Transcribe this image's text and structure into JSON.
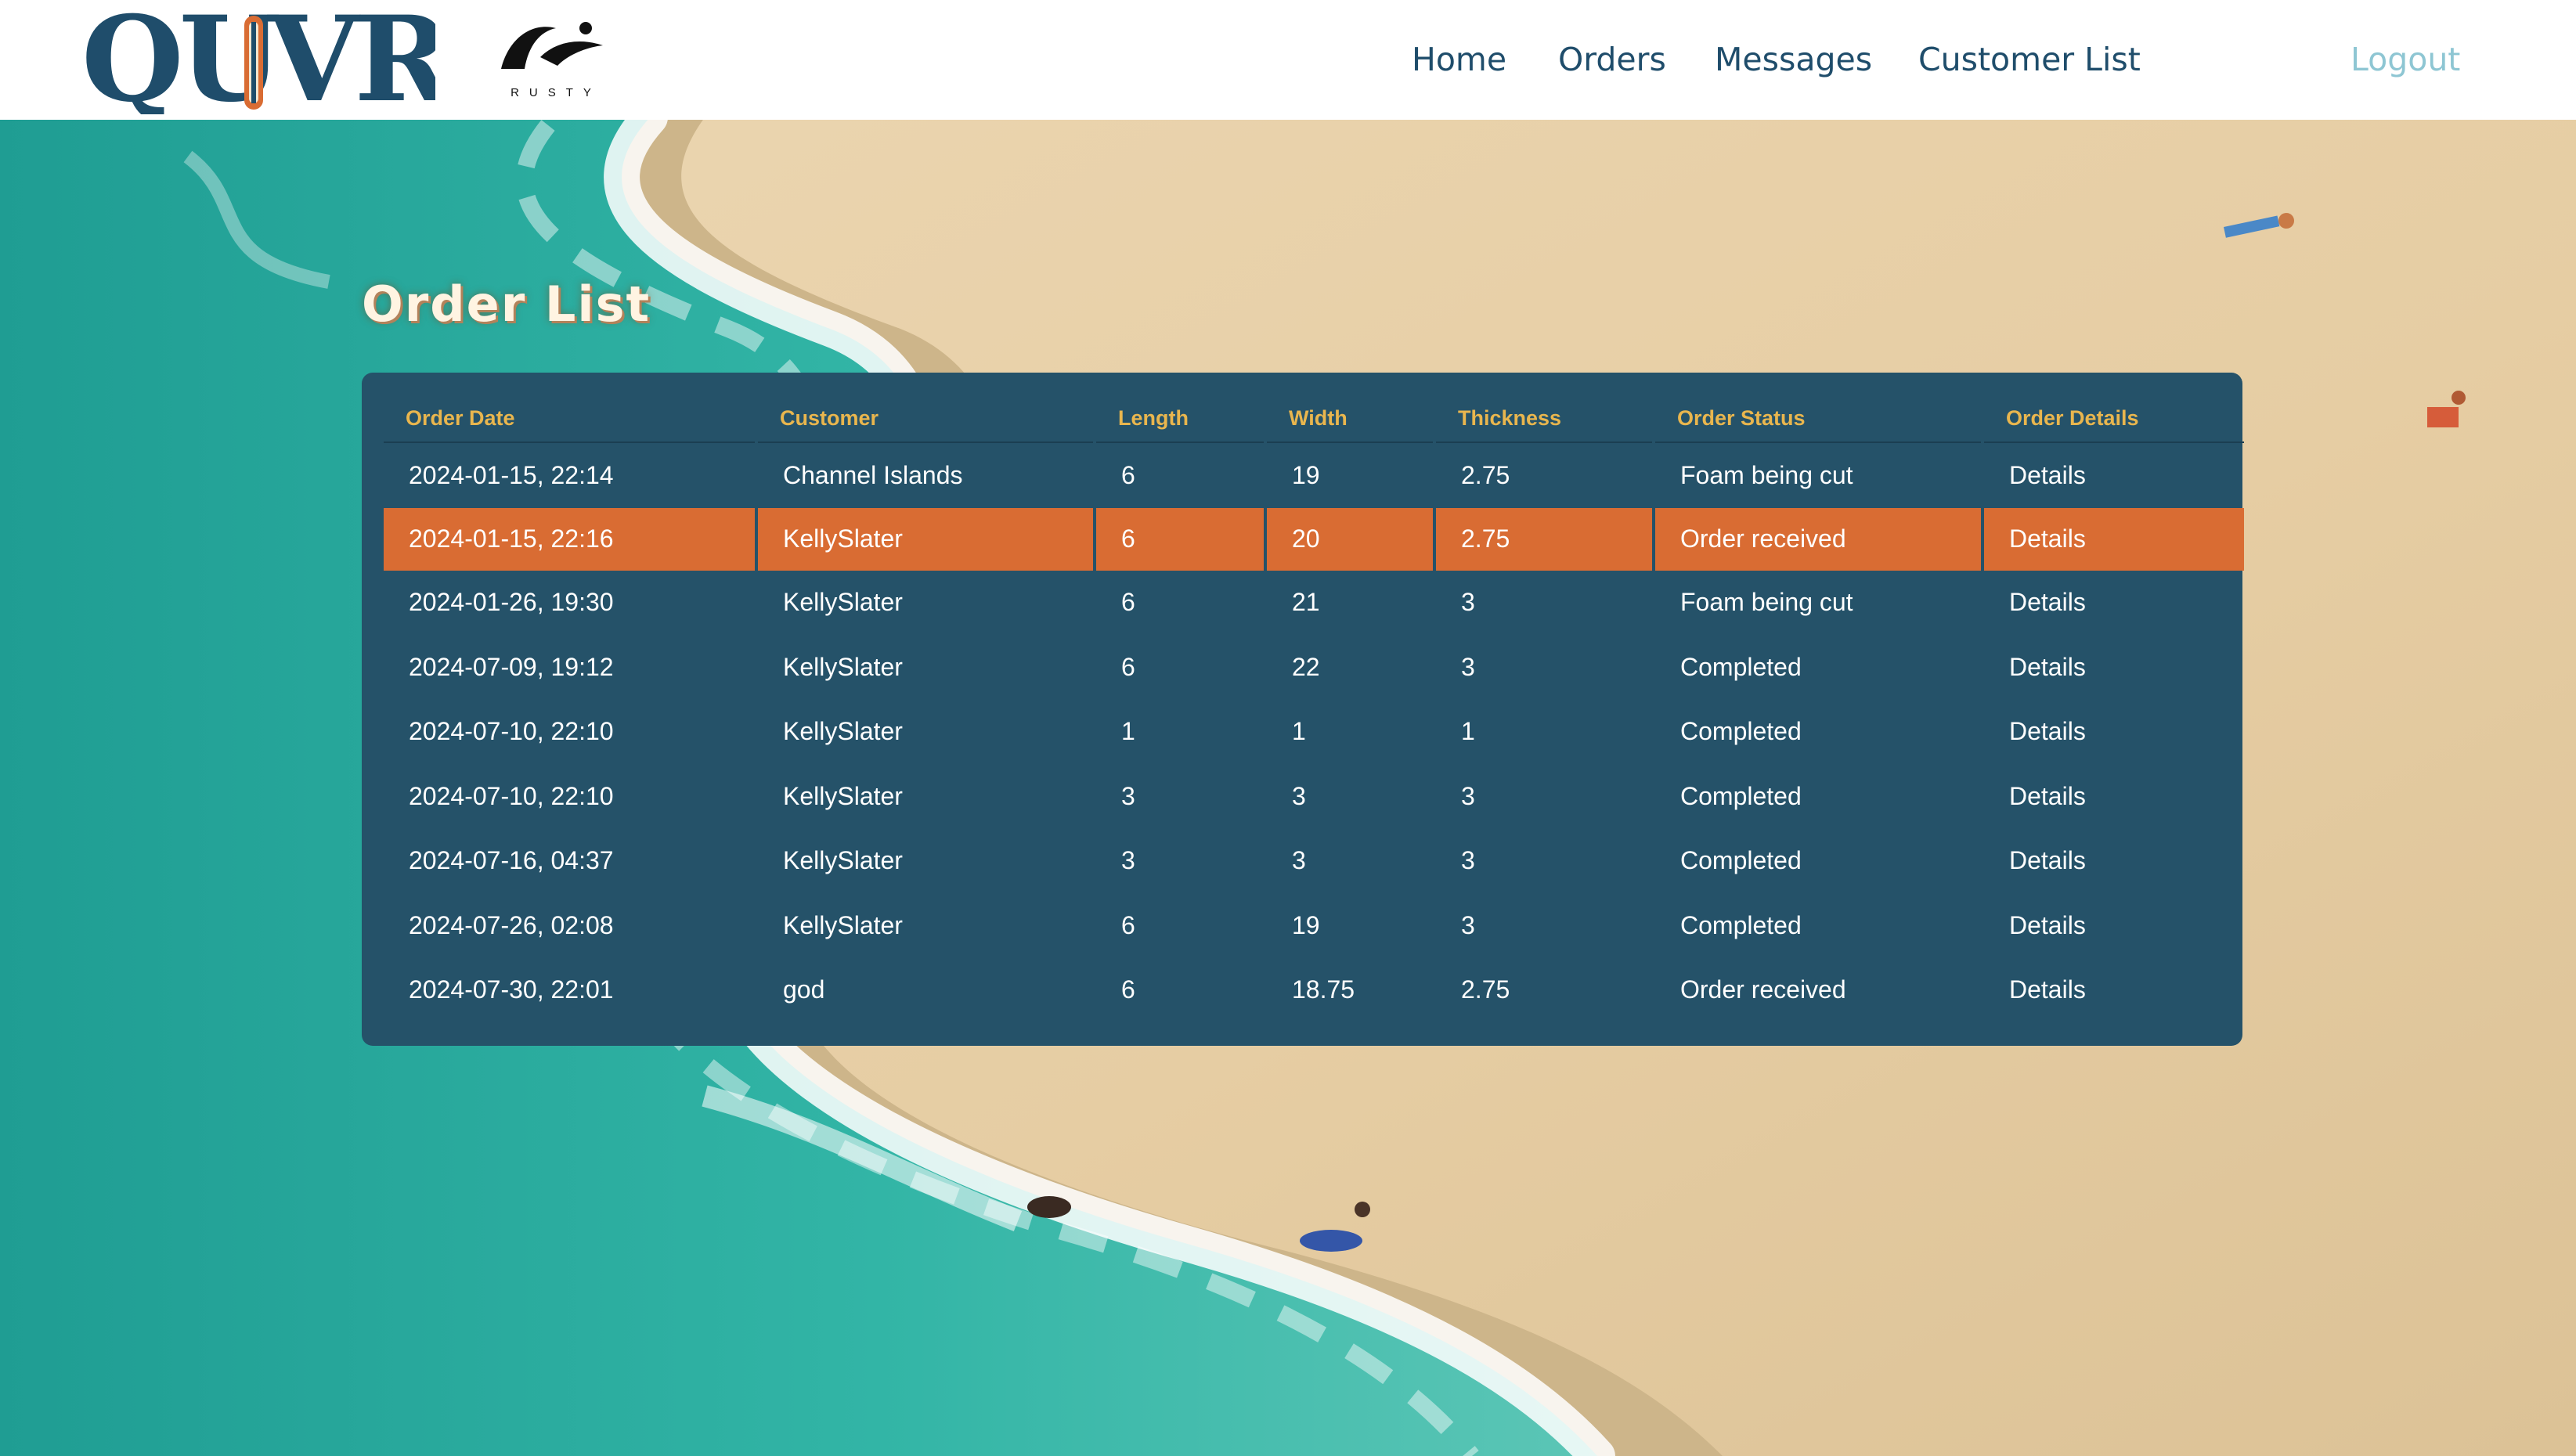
{
  "header": {
    "logo_text": "QUIVR",
    "partner_logo_text": "RUSTY",
    "nav": [
      {
        "label": "Home"
      },
      {
        "label": "Orders"
      },
      {
        "label": "Messages"
      },
      {
        "label": "Customer List"
      }
    ],
    "logout_label": "Logout"
  },
  "page_title": "Order List",
  "table": {
    "columns": [
      "Order Date",
      "Customer",
      "Length",
      "Width",
      "Thickness",
      "Order Status",
      "Order Details"
    ],
    "rows": [
      {
        "date": "2024-01-15, 22:14",
        "customer": "Channel Islands",
        "length": "6",
        "width": "19",
        "thickness": "2.75",
        "status": "Foam being cut",
        "details": "Details"
      },
      {
        "date": "2024-01-15, 22:16",
        "customer": "KellySlater",
        "length": "6",
        "width": "20",
        "thickness": "2.75",
        "status": "Order received",
        "details": "Details"
      },
      {
        "date": "2024-01-26, 19:30",
        "customer": "KellySlater",
        "length": "6",
        "width": "21",
        "thickness": "3",
        "status": "Foam being cut",
        "details": "Details"
      },
      {
        "date": "2024-07-09, 19:12",
        "customer": "KellySlater",
        "length": "6",
        "width": "22",
        "thickness": "3",
        "status": "Completed",
        "details": "Details"
      },
      {
        "date": "2024-07-10, 22:10",
        "customer": "KellySlater",
        "length": "1",
        "width": "1",
        "thickness": "1",
        "status": "Completed",
        "details": "Details"
      },
      {
        "date": "2024-07-10, 22:10",
        "customer": "KellySlater",
        "length": "3",
        "width": "3",
        "thickness": "3",
        "status": "Completed",
        "details": "Details"
      },
      {
        "date": "2024-07-16, 04:37",
        "customer": "KellySlater",
        "length": "3",
        "width": "3",
        "thickness": "3",
        "status": "Completed",
        "details": "Details"
      },
      {
        "date": "2024-07-26, 02:08",
        "customer": "KellySlater",
        "length": "6",
        "width": "19",
        "thickness": "3",
        "status": "Completed",
        "details": "Details"
      },
      {
        "date": "2024-07-30, 22:01",
        "customer": "god",
        "length": "6",
        "width": "18.75",
        "thickness": "2.75",
        "status": "Order received",
        "details": "Details"
      }
    ]
  },
  "colors": {
    "nav_text": "#1f4d6b",
    "logout_text": "#8ec6d3",
    "card_bg": "#255269",
    "header_text": "#e9b64e",
    "selected_row": "#d96c33"
  }
}
